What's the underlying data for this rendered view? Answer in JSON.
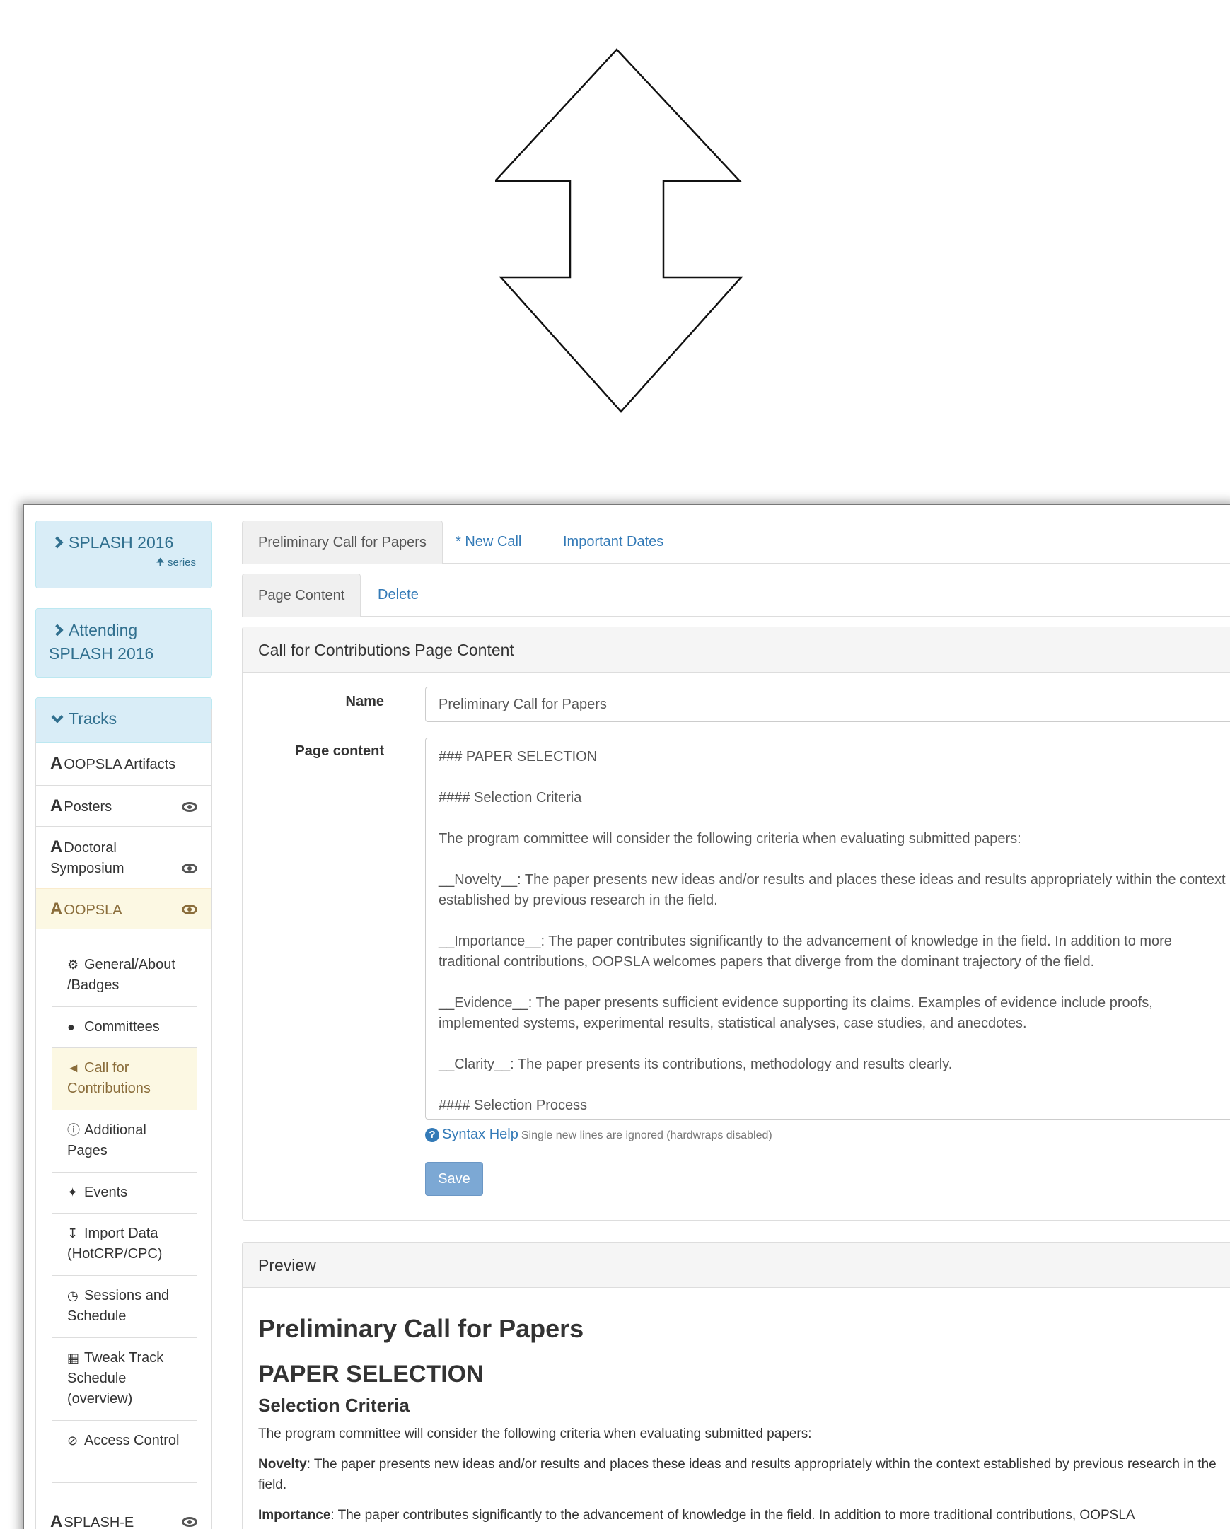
{
  "sidebar": {
    "conference": "SPLASH 2016",
    "series_link": "series",
    "attending": "Attending SPLASH 2016",
    "tracks_heading": "Tracks",
    "tracks": [
      {
        "label": "OOPSLA Artifacts"
      },
      {
        "label": "Posters"
      },
      {
        "label": "Doctoral Symposium"
      },
      {
        "label": "OOPSLA"
      },
      {
        "label": "SPLASH-E"
      }
    ],
    "oopsla_menu": [
      {
        "label": "General/About /Badges",
        "icon": "gear-icon"
      },
      {
        "label": "Committees",
        "icon": "user-icon"
      },
      {
        "label": "Call for Contributions",
        "icon": "bullhorn-icon"
      },
      {
        "label": "Additional Pages",
        "icon": "info-icon"
      },
      {
        "label": "Events",
        "icon": "pushpin-icon"
      },
      {
        "label": "Import Data (HotCRP/CPC)",
        "icon": "import-icon"
      },
      {
        "label": "Sessions and Schedule",
        "icon": "clock-icon"
      },
      {
        "label": "Tweak Track Schedule (overview)",
        "icon": "calendar-icon"
      },
      {
        "label": "Access Control",
        "icon": "ban-icon"
      }
    ]
  },
  "tabs": {
    "primary": [
      "Preliminary Call for Papers",
      "* New Call",
      "Important Dates"
    ],
    "secondary": [
      "Page Content",
      "Delete"
    ]
  },
  "form": {
    "panel_title": "Call for Contributions Page Content",
    "name_label": "Name",
    "name_value": "Preliminary Call for Papers",
    "content_label": "Page content",
    "content_lines": [
      "### PAPER SELECTION",
      "#### Selection Criteria",
      "The program committee will consider the following criteria when evaluating submitted papers:",
      "__Novelty__: The paper presents new ideas and/or results and places these ideas and results appropriately within the context established by previous research in the field.",
      "__Importance__: The paper contributes significantly to the advancement of knowledge in the field. In addition to more traditional contributions, OOPSLA welcomes papers that diverge from the dominant trajectory of the field.",
      "__Evidence__: The paper presents sufficient evidence supporting its claims. Examples of evidence include proofs, implemented systems, experimental results, statistical analyses, case studies, and anecdotes.",
      "__Clarity__: The paper presents its contributions, methodology and results clearly.",
      "#### Selection Process"
    ],
    "syntax_help": "Syntax Help",
    "syntax_hint": "Single new lines are ignored (hardwraps disabled)",
    "save_label": "Save"
  },
  "preview": {
    "panel_title": "Preview",
    "title": "Preliminary Call for Papers",
    "h2": "PAPER SELECTION",
    "h3": "Selection Criteria",
    "intro": "The program committee will consider the following criteria when evaluating submitted papers:",
    "novelty_term": "Novelty",
    "novelty_text": ": The paper presents new ideas and/or results and places these ideas and results appropriately within the context established by previous research in the field.",
    "importance_term": "Importance",
    "importance_text": ": The paper contributes significantly to the advancement of knowledge in the field. In addition to more traditional contributions, OOPSLA"
  },
  "colors": {
    "link": "#337ab7",
    "info_bg": "#d9edf7",
    "active_bg": "#fcf8e3",
    "active_text": "#8a6d3b"
  }
}
